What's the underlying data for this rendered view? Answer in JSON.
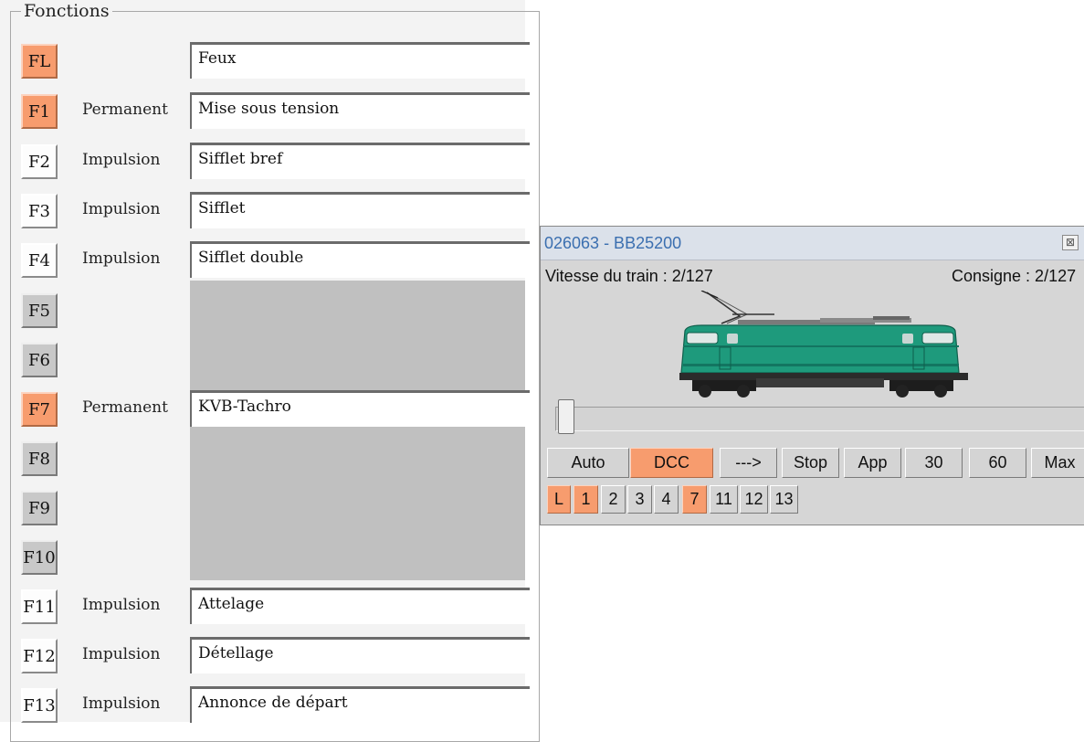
{
  "fonctions": {
    "legend": "Fonctions",
    "rows": [
      {
        "key": "FL",
        "mode": "",
        "name": "Feux",
        "state": "active"
      },
      {
        "key": "F1",
        "mode": "Permanent",
        "name": "Mise sous tension",
        "state": "active"
      },
      {
        "key": "F2",
        "mode": "Impulsion",
        "name": "Sifflet bref",
        "state": "inactive"
      },
      {
        "key": "F3",
        "mode": "Impulsion",
        "name": "Sifflet",
        "state": "inactive"
      },
      {
        "key": "F4",
        "mode": "Impulsion",
        "name": "Sifflet double",
        "state": "inactive"
      },
      {
        "key": "F5",
        "mode": "",
        "name": null,
        "state": "unassigned"
      },
      {
        "key": "F6",
        "mode": "",
        "name": null,
        "state": "unassigned"
      },
      {
        "key": "F7",
        "mode": "Permanent",
        "name": "KVB-Tachro",
        "state": "active"
      },
      {
        "key": "F8",
        "mode": "",
        "name": null,
        "state": "unassigned"
      },
      {
        "key": "F9",
        "mode": "",
        "name": null,
        "state": "unassigned"
      },
      {
        "key": "F10",
        "mode": "",
        "name": null,
        "state": "unassigned"
      },
      {
        "key": "F11",
        "mode": "Impulsion",
        "name": "Attelage",
        "state": "inactive"
      },
      {
        "key": "F12",
        "mode": "Impulsion",
        "name": "Détellage",
        "state": "inactive"
      },
      {
        "key": "F13",
        "mode": "Impulsion",
        "name": "Annonce de départ",
        "state": "inactive"
      }
    ]
  },
  "loco": {
    "title": "026063 - BB25200",
    "close_icon": "close-icon",
    "speed_text": "Vitesse du train : 2/127",
    "consigne_text": "Consigne : 2/127",
    "image": "green-electric-locomotive",
    "slider_value": 2,
    "slider_max": 127,
    "controls": [
      {
        "label": "Auto",
        "active": false
      },
      {
        "label": "DCC",
        "active": true
      },
      {
        "label": "--->",
        "active": false
      },
      {
        "label": "Stop",
        "active": false
      },
      {
        "label": "App",
        "active": false
      },
      {
        "label": "30",
        "active": false
      },
      {
        "label": "60",
        "active": false
      },
      {
        "label": "Max",
        "active": false
      }
    ],
    "function_buttons": [
      {
        "label": "L",
        "active": true
      },
      {
        "label": "1",
        "active": true
      },
      {
        "label": "2",
        "active": false
      },
      {
        "label": "3",
        "active": false
      },
      {
        "label": "4",
        "active": false
      },
      {
        "label": "7",
        "active": true
      },
      {
        "label": "11",
        "active": false
      },
      {
        "label": "12",
        "active": false
      },
      {
        "label": "13",
        "active": false
      }
    ]
  },
  "colors": {
    "active": "#f79c6e",
    "window_bg": "#d6d6d6",
    "title_text": "#3b6fb0",
    "loco_body": "#1e9a7c"
  }
}
